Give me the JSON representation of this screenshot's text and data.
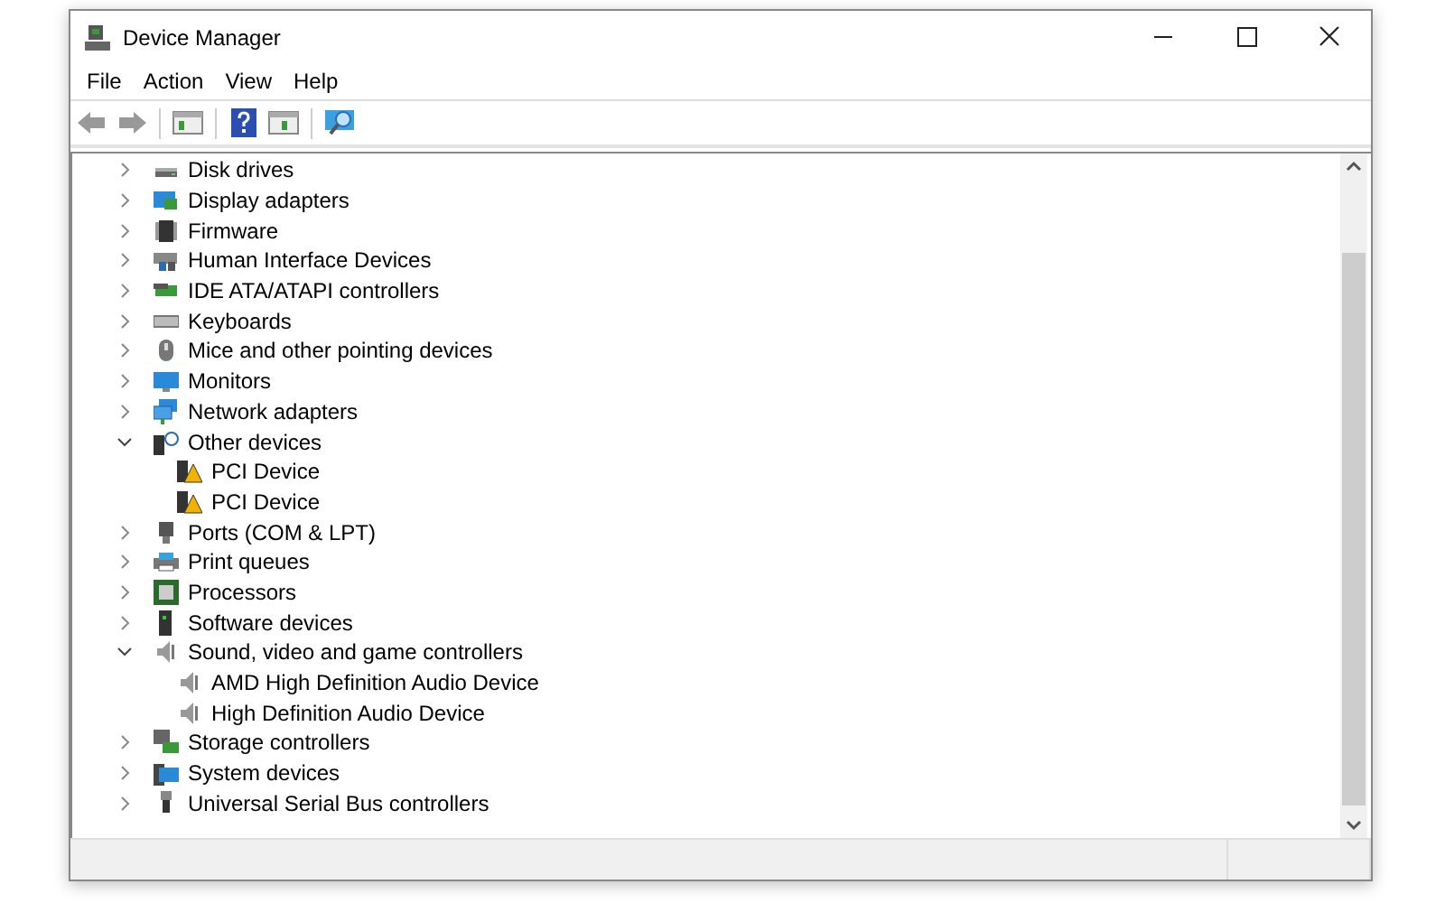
{
  "window": {
    "title": "Device Manager"
  },
  "menu": [
    "File",
    "Action",
    "View",
    "Help"
  ],
  "tree": [
    {
      "label": "Disk drives",
      "kind": "drive",
      "expanded": false
    },
    {
      "label": "Display adapters",
      "kind": "display",
      "expanded": false
    },
    {
      "label": "Firmware",
      "kind": "chip",
      "expanded": false
    },
    {
      "label": "Human Interface Devices",
      "kind": "hid",
      "expanded": false
    },
    {
      "label": "IDE ATA/ATAPI controllers",
      "kind": "card",
      "expanded": false
    },
    {
      "label": "Keyboards",
      "kind": "keyboard",
      "expanded": false
    },
    {
      "label": "Mice and other pointing devices",
      "kind": "mouse",
      "expanded": false
    },
    {
      "label": "Monitors",
      "kind": "monitor",
      "expanded": false
    },
    {
      "label": "Network adapters",
      "kind": "network",
      "expanded": false
    },
    {
      "label": "Other devices",
      "kind": "unknown",
      "expanded": true,
      "children": [
        {
          "label": "PCI Device",
          "kind": "warning"
        },
        {
          "label": "PCI Device",
          "kind": "warning"
        }
      ]
    },
    {
      "label": "Ports (COM & LPT)",
      "kind": "port",
      "expanded": false
    },
    {
      "label": "Print queues",
      "kind": "printer",
      "expanded": false
    },
    {
      "label": "Processors",
      "kind": "processor",
      "expanded": false
    },
    {
      "label": "Software devices",
      "kind": "tower",
      "expanded": false
    },
    {
      "label": "Sound, video and game controllers",
      "kind": "speaker",
      "expanded": true,
      "children": [
        {
          "label": "AMD High Definition Audio Device",
          "kind": "speaker"
        },
        {
          "label": "High Definition Audio Device",
          "kind": "speaker"
        }
      ]
    },
    {
      "label": "Storage controllers",
      "kind": "storage",
      "expanded": false
    },
    {
      "label": "System devices",
      "kind": "system",
      "expanded": false
    },
    {
      "label": "Universal Serial Bus controllers",
      "kind": "usb",
      "expanded": false
    }
  ]
}
